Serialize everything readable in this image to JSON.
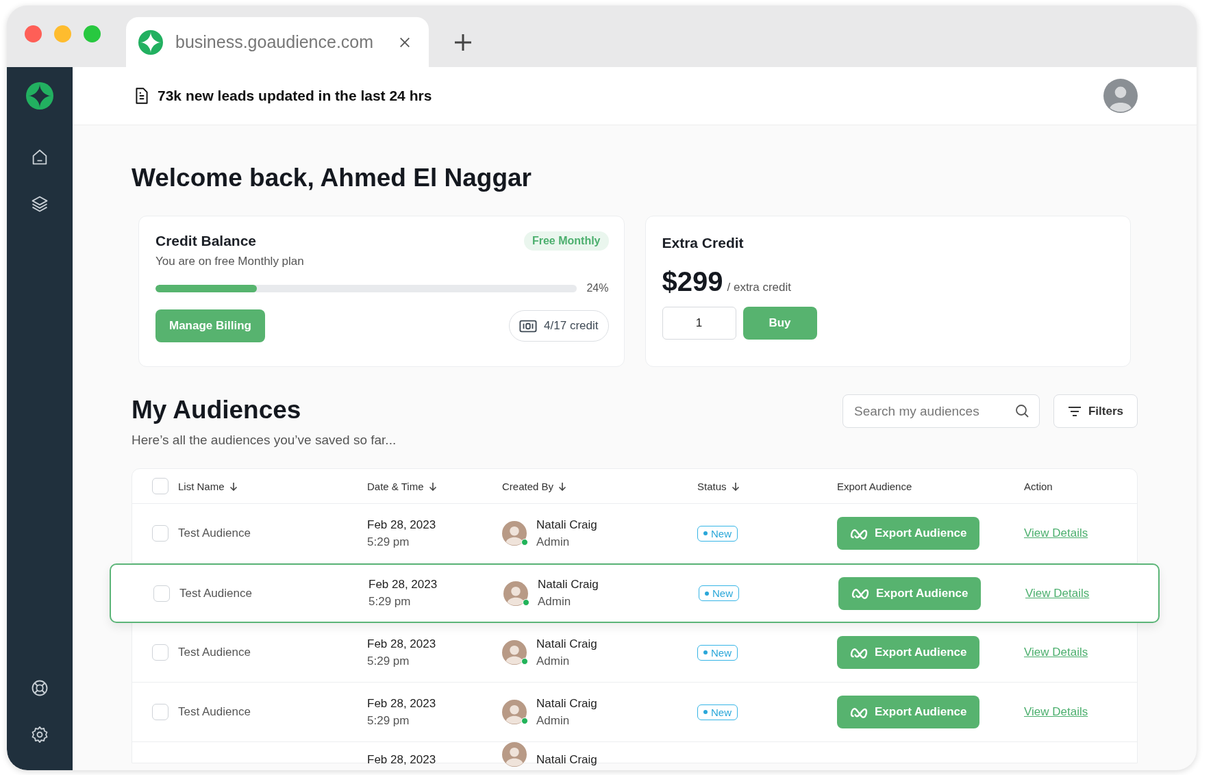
{
  "browser": {
    "tab_title": "business.goaudience.com"
  },
  "banner": {
    "text": "**73k** new leads updated in the last 24 hrs"
  },
  "welcome": "Welcome back, Ahmed El Naggar",
  "credit_balance": {
    "title": "Credit Balance",
    "subtitle": "You are on free Monthly plan",
    "badge": "Free Monthly",
    "level": 0.24,
    "percent": "24%",
    "button": "Manage Billing",
    "credit": "4/17 credit"
  },
  "extra_credit": {
    "title": "Extra Credit",
    "price": "$299",
    "unit": "/ extra credit",
    "quantity": "1",
    "button": "Buy"
  },
  "audiences": {
    "title": "My Audiences",
    "subtitle": "Here’s all the audiences you’ve saved so far...",
    "search_placeholder": "Search my audiences",
    "filters": "Filters",
    "select_all_checked": false,
    "columns": [
      {
        "label": "List Name",
        "sortable": true
      },
      {
        "label": "Date & Time",
        "sortable": true
      },
      {
        "label": "Created By",
        "sortable": true
      },
      {
        "label": "Status",
        "sortable": true
      },
      {
        "label": "Export Audience",
        "sortable": false
      },
      {
        "label": "Action",
        "sortable": false
      }
    ],
    "rows": [
      {
        "kind": "full",
        "checked": false,
        "highlighted": false,
        "name": "Test Audience",
        "date": "Feb 28, 2023",
        "time": "5:29 pm",
        "creator": "Natali Craig",
        "role": "Admin",
        "online": true,
        "status": "New",
        "export": "Export Audience",
        "action": "View Details"
      },
      {
        "kind": "full",
        "checked": false,
        "highlighted": true,
        "name": "Test Audience",
        "date": "Feb 28, 2023",
        "time": "5:29 pm",
        "creator": "Natali Craig",
        "role": "Admin",
        "online": true,
        "status": "New",
        "export": "Export Audience",
        "action": "View Details"
      },
      {
        "kind": "full",
        "checked": false,
        "highlighted": false,
        "name": "Test Audience",
        "date": "Feb 28, 2023",
        "time": "5:29 pm",
        "creator": "Natali Craig",
        "role": "Admin",
        "online": true,
        "status": "New",
        "export": "Export Audience",
        "action": "View Details"
      },
      {
        "kind": "full",
        "checked": false,
        "highlighted": false,
        "name": "Test Audience",
        "date": "Feb 28, 2023",
        "time": "5:29 pm",
        "creator": "Natali Craig",
        "role": "Admin",
        "online": true,
        "status": "New",
        "export": "Export Audience",
        "action": "View Details"
      },
      {
        "kind": "partial",
        "date": "Feb 28, 2023",
        "creator": "Natali Craig"
      }
    ]
  }
}
